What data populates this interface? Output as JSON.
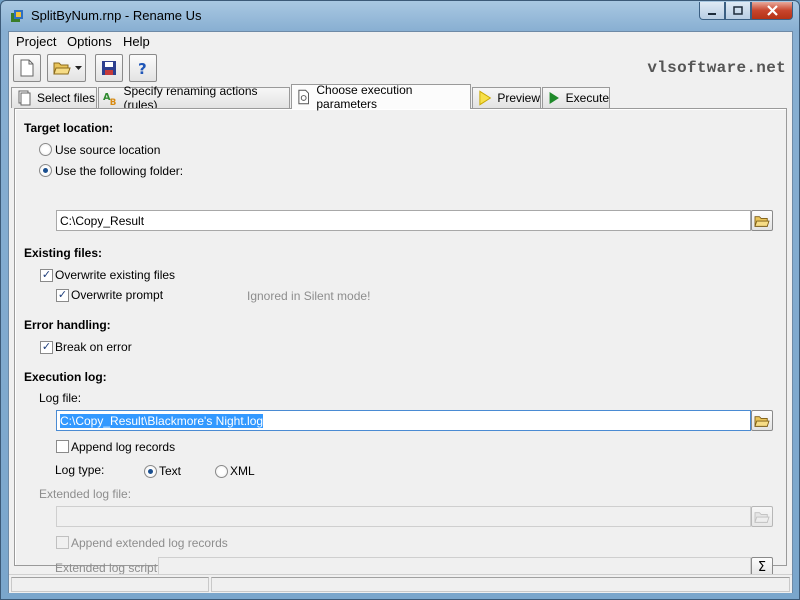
{
  "window": {
    "title": "SplitByNum.rnp - Rename Us"
  },
  "menu": {
    "items": [
      "Project",
      "Options",
      "Help"
    ]
  },
  "toolbar": {
    "brand": "vlsoftware.net"
  },
  "tabs": [
    {
      "label": "Select files",
      "icon": "files-icon"
    },
    {
      "label": "Specify renaming actions (rules)",
      "icon": "rules-icon"
    },
    {
      "label": "Choose execution parameters",
      "icon": "parameters-icon",
      "active": true
    },
    {
      "label": "Preview",
      "icon": "preview-icon"
    },
    {
      "label": "Execute",
      "icon": "play-icon"
    }
  ],
  "target": {
    "heading": "Target location:",
    "source_option": "Use source location",
    "folder_option": "Use the following folder:",
    "selected": "folder",
    "folder_value": "C:\\Copy_Result"
  },
  "existing": {
    "heading": "Existing files:",
    "overwrite_label": "Overwrite existing files",
    "overwrite_checked": true,
    "prompt_label": "Overwrite prompt",
    "prompt_checked": true,
    "silent_note": "Ignored in Silent mode!"
  },
  "errors": {
    "heading": "Error handling:",
    "break_label": "Break on error",
    "break_checked": true
  },
  "log": {
    "heading": "Execution log:",
    "file_label": "Log file:",
    "file_value": "C:\\Copy_Result\\Blackmore's Night.log",
    "append_label": "Append log records",
    "append_checked": false,
    "type_label": "Log type:",
    "type_text": "Text",
    "type_xml": "XML",
    "type_selected": "Text",
    "ext_file_label": "Extended log file:",
    "ext_file_value": "",
    "ext_append_label": "Append extended log records",
    "ext_script_label": "Extended log script:",
    "ext_script_value": ""
  }
}
